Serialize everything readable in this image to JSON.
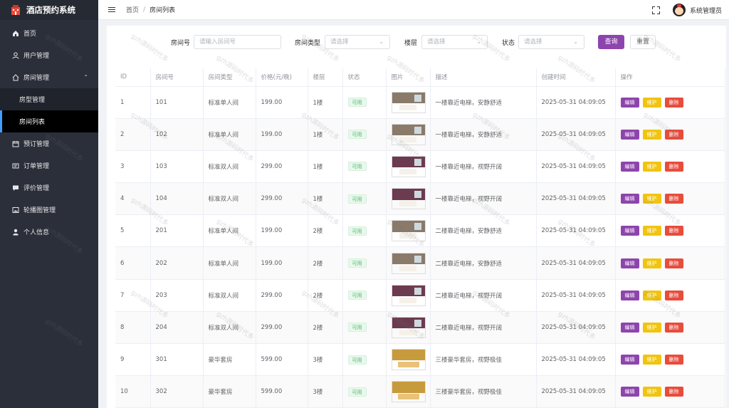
{
  "app": {
    "title": "酒店预约系统"
  },
  "sidebar": {
    "items": [
      {
        "label": "首页",
        "icon": "home-icon"
      },
      {
        "label": "用户管理",
        "icon": "user-icon"
      },
      {
        "label": "房间管理",
        "icon": "house-icon",
        "expanded": true
      },
      {
        "label": "房型管理",
        "sub": true
      },
      {
        "label": "房间列表",
        "sub": true,
        "active": true
      },
      {
        "label": "预订管理",
        "icon": "calendar-icon"
      },
      {
        "label": "订单管理",
        "icon": "order-icon"
      },
      {
        "label": "评价管理",
        "icon": "comment-icon"
      },
      {
        "label": "轮播图管理",
        "icon": "picture-icon"
      },
      {
        "label": "个人信息",
        "icon": "person-icon"
      }
    ]
  },
  "header": {
    "breadcrumb": [
      "首页",
      "房间列表"
    ],
    "separator": "/",
    "username": "系统管理员"
  },
  "search": {
    "room_no_label": "房间号",
    "room_no_placeholder": "请输入房间号",
    "room_type_label": "房间类型",
    "room_type_placeholder": "请选择",
    "floor_label": "楼层",
    "floor_placeholder": "请选择",
    "status_label": "状态",
    "status_placeholder": "请选择",
    "query_label": "查询",
    "reset_label": "重置"
  },
  "table": {
    "headers": [
      "ID",
      "房间号",
      "房间类型",
      "价格(元/晚)",
      "楼层",
      "状态",
      "图片",
      "描述",
      "创建时间",
      "操作"
    ],
    "actions": {
      "edit": "编辑",
      "maintain": "维护",
      "delete": "删除"
    },
    "rows": [
      {
        "id": "1",
        "room_no": "101",
        "type": "标准单人间",
        "price": "199.00",
        "floor": "1楼",
        "status": "可用",
        "image": "single-room",
        "desc": "一楼靠近电梯，安静舒适",
        "created": "2025-05-31 04:09:05"
      },
      {
        "id": "2",
        "room_no": "102",
        "type": "标准单人间",
        "price": "199.00",
        "floor": "1楼",
        "status": "可用",
        "image": "single-room",
        "desc": "一楼靠近电梯，安静舒适",
        "created": "2025-05-31 04:09:05"
      },
      {
        "id": "3",
        "room_no": "103",
        "type": "标准双人间",
        "price": "299.00",
        "floor": "1楼",
        "status": "可用",
        "image": "double-room",
        "desc": "一楼靠近电梯，视野开阔",
        "created": "2025-05-31 04:09:05"
      },
      {
        "id": "4",
        "room_no": "104",
        "type": "标准双人间",
        "price": "299.00",
        "floor": "1楼",
        "status": "可用",
        "image": "double-room",
        "desc": "一楼靠近电梯，视野开阔",
        "created": "2025-05-31 04:09:05"
      },
      {
        "id": "5",
        "room_no": "201",
        "type": "标准单人间",
        "price": "199.00",
        "floor": "2楼",
        "status": "可用",
        "image": "single-room",
        "desc": "二楼靠近电梯，安静舒适",
        "created": "2025-05-31 04:09:05"
      },
      {
        "id": "6",
        "room_no": "202",
        "type": "标准单人间",
        "price": "199.00",
        "floor": "2楼",
        "status": "可用",
        "image": "single-room",
        "desc": "二楼靠近电梯，安静舒适",
        "created": "2025-05-31 04:09:05"
      },
      {
        "id": "7",
        "room_no": "203",
        "type": "标准双人间",
        "price": "299.00",
        "floor": "2楼",
        "status": "可用",
        "image": "double-room",
        "desc": "二楼靠近电梯，视野开阔",
        "created": "2025-05-31 04:09:05"
      },
      {
        "id": "8",
        "room_no": "204",
        "type": "标准双人间",
        "price": "299.00",
        "floor": "2楼",
        "status": "可用",
        "image": "double-room",
        "desc": "二楼靠近电梯，视野开阔",
        "created": "2025-05-31 04:09:05"
      },
      {
        "id": "9",
        "room_no": "301",
        "type": "豪华套房",
        "price": "599.00",
        "floor": "3楼",
        "status": "可用",
        "image": "suite-room",
        "desc": "三楼豪华套房，视野极佳",
        "created": "2025-05-31 04:09:05"
      },
      {
        "id": "10",
        "room_no": "302",
        "type": "豪华套房",
        "price": "599.00",
        "floor": "3楼",
        "status": "可用",
        "image": "suite-room",
        "desc": "三楼豪华套房，视野极佳",
        "created": "2025-05-31 04:09:05"
      }
    ]
  },
  "colors": {
    "primary": "#8e44ad",
    "warning": "#f1c40f",
    "danger": "#e74c3c",
    "success_tag": "#4cb96a",
    "sidebar_bg": "#2b2f3a",
    "active_indicator": "#409eff"
  },
  "watermark_text": "gzh源码时代多"
}
